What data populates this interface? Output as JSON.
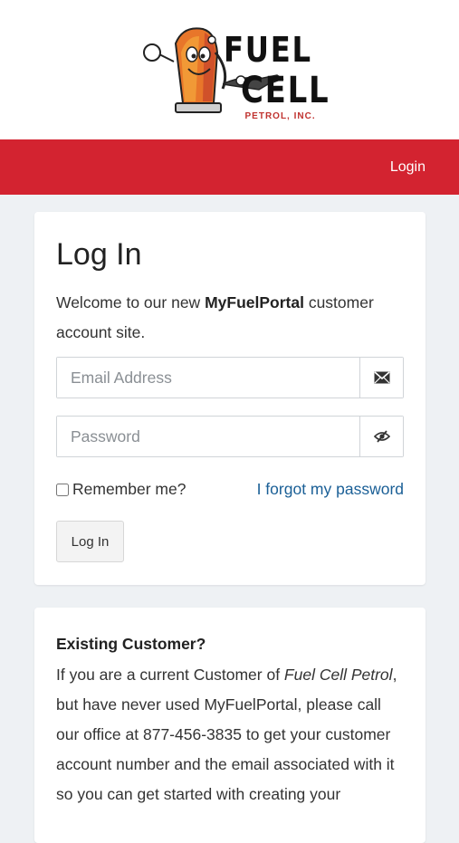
{
  "brand": {
    "logo_line1": "FUEL",
    "logo_line2": "CELL",
    "logo_sub": "PETROL, INC.",
    "accent_color": "#d32330"
  },
  "nav": {
    "login_label": "Login"
  },
  "login_card": {
    "title": "Log In",
    "welcome_prefix": "Welcome to our new ",
    "welcome_brand": "MyFuelPortal",
    "welcome_suffix": " customer account site.",
    "email_placeholder": "Email Address",
    "email_icon": "envelope-icon",
    "password_placeholder": "Password",
    "password_icon": "eye-slash-icon",
    "remember_label": "Remember me?",
    "forgot_label": "I forgot my password",
    "submit_label": "Log In"
  },
  "existing_card": {
    "title": "Existing Customer?",
    "body_prefix": "If you are a current Customer of ",
    "body_company": "Fuel Cell Petrol",
    "body_suffix": ", but have never used MyFuelPortal, please call our office at 877-456-3835 to get your customer account number and the email associated with it so you can get started with creating your"
  }
}
